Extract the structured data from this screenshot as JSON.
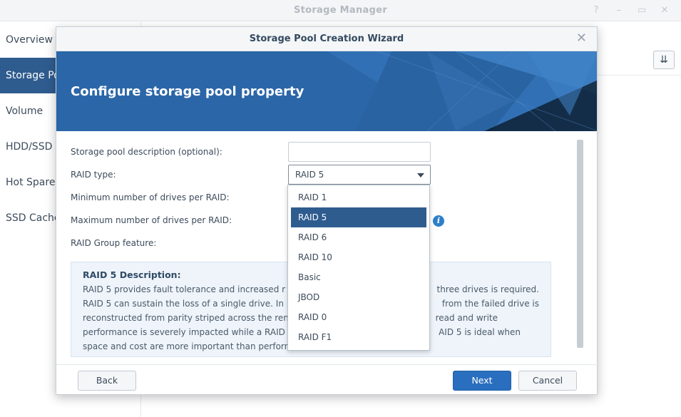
{
  "app": {
    "title": "Storage Manager",
    "window_controls": [
      "?",
      "–",
      "▭",
      "✕"
    ],
    "sidebar": [
      {
        "label": "Overview",
        "active": false
      },
      {
        "label": "Storage Pool",
        "active": true
      },
      {
        "label": "Volume",
        "active": false
      },
      {
        "label": "HDD/SSD",
        "active": false
      },
      {
        "label": "Hot Spare",
        "active": false
      },
      {
        "label": "SSD Cache",
        "active": false
      }
    ],
    "sort_icon": "⇊"
  },
  "wizard": {
    "title": "Storage Pool Creation Wizard",
    "close_icon": "✕",
    "banner_title": "Configure storage pool property",
    "fields": {
      "description_label": "Storage pool description (optional):",
      "description_value": "",
      "raid_type_label": "RAID type:",
      "raid_type_value": "RAID 5",
      "min_drives_label": "Minimum number of drives per RAID:",
      "max_drives_label": "Maximum number of drives per RAID:",
      "raid_group_label": "RAID Group feature:"
    },
    "info_icon": "i",
    "description_box": {
      "title": "RAID 5 Description:",
      "lines": [
        "RAID 5 provides fault tolerance and increased r",
        "RAID 5 can sustain the loss of a single drive. In",
        "reconstructed from parity striped across the ren",
        "performance is severely impacted while a RAID",
        "space and cost are more important than perforn"
      ],
      "lines_right": [
        "three drives is required.",
        "from the failed drive is",
        "read and write",
        "AID 5 is ideal when",
        ""
      ]
    },
    "dropdown_options": [
      "RAID 1",
      "RAID 5",
      "RAID 6",
      "RAID 10",
      "Basic",
      "JBOD",
      "RAID 0",
      "RAID F1"
    ],
    "dropdown_selected": "RAID 5",
    "buttons": {
      "back": "Back",
      "next": "Next",
      "cancel": "Cancel"
    }
  },
  "colors": {
    "accent": "#2f5c8f",
    "banner": "#2b66a8",
    "primary_button": "#2a6fbf"
  }
}
